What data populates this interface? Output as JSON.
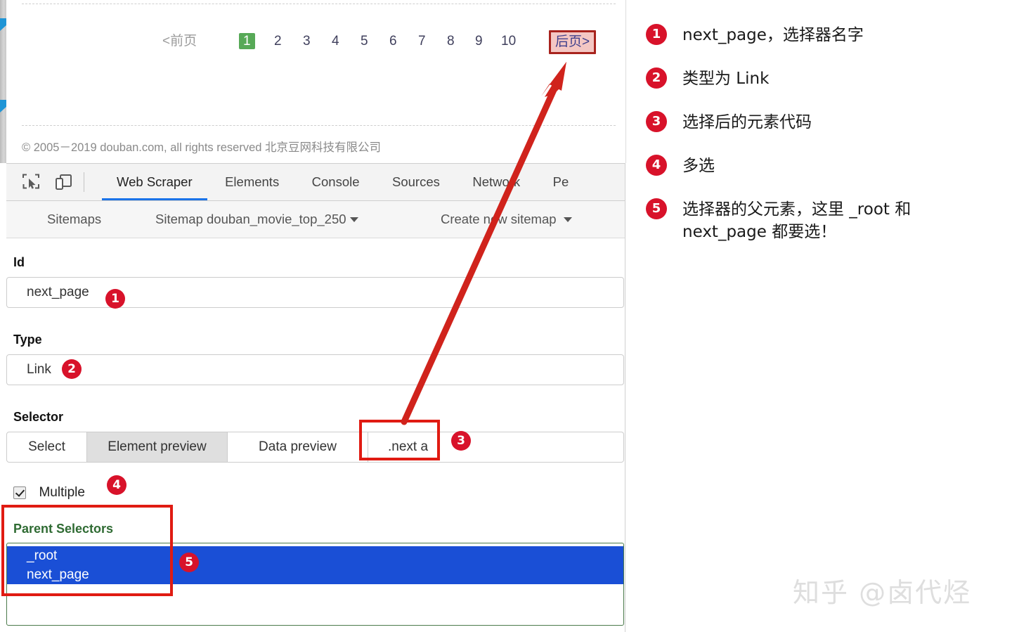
{
  "webpage": {
    "pagination": {
      "prev_label": "<前页",
      "pages": [
        "1",
        "2",
        "3",
        "4",
        "5",
        "6",
        "7",
        "8",
        "9",
        "10"
      ],
      "current_page": "1",
      "next_label": "后页>",
      "current_page_bg": "#57a957",
      "next_highlight_bg": "#f4c7c3",
      "next_highlight_border": "#a8231d"
    },
    "copyright": "© 2005－2019 douban.com, all rights reserved 北京豆网科技有限公司"
  },
  "devtools": {
    "icons": {
      "inspect": "inspect-element-icon",
      "device": "device-toolbar-icon"
    },
    "tabs": [
      {
        "label": "Web Scraper",
        "active": true
      },
      {
        "label": "Elements",
        "active": false
      },
      {
        "label": "Console",
        "active": false
      },
      {
        "label": "Sources",
        "active": false
      },
      {
        "label": "Network",
        "active": false
      },
      {
        "label": "Pe",
        "active": false
      }
    ],
    "active_tab_underline": "#1a73e8"
  },
  "webscraper": {
    "navbar": {
      "sitemaps": "Sitemaps",
      "sitemap": "Sitemap douban_movie_top_250",
      "create": "Create new sitemap"
    },
    "form": {
      "id_label": "Id",
      "id_value": "next_page",
      "type_label": "Type",
      "type_value": "Link",
      "selector_label": "Selector",
      "select_button": "Select",
      "element_preview_button": "Element preview",
      "data_preview_button": "Data preview",
      "selector_value": ".next a",
      "multiple_label": "Multiple",
      "multiple_checked": true,
      "parent_selectors_label": "Parent Selectors",
      "parent_options": [
        {
          "label": "_root",
          "selected": true
        },
        {
          "label": "next_page",
          "selected": true
        }
      ],
      "parent_selected_bg": "#1a4fd6",
      "parent_label_color": "#2f6b33"
    }
  },
  "markers": {
    "m1": "1",
    "m2": "2",
    "m3": "3",
    "m4": "4",
    "m5": "5",
    "color": "#d8122a"
  },
  "notes": [
    {
      "num": "1",
      "text": "next_page，选择器名字"
    },
    {
      "num": "2",
      "text": "类型为 Link"
    },
    {
      "num": "3",
      "text": "选择后的元素代码"
    },
    {
      "num": "4",
      "text": "多选"
    },
    {
      "num": "5",
      "text": "选择器的父元素，这里 _root 和 next_page 都要选！"
    }
  ],
  "watermark": "知乎 @卤代烃"
}
